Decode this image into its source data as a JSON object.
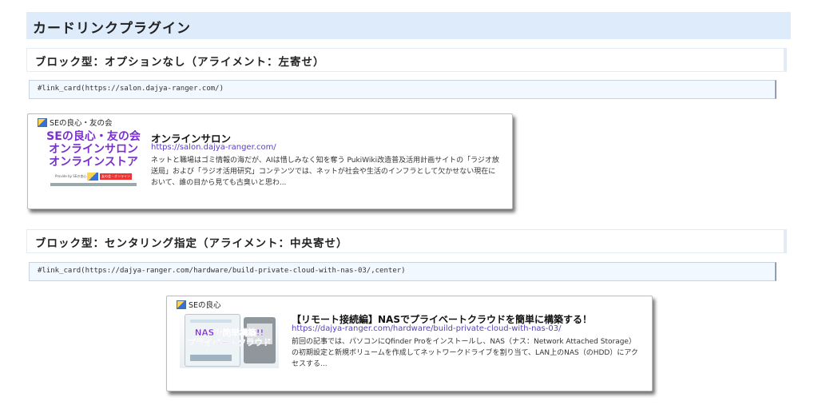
{
  "page": {
    "title": "カードリンクプラグイン"
  },
  "section1": {
    "heading": "ブロック型：オプションなし（アライメント：左寄せ）",
    "code": "#link_card(https://salon.dajya-ranger.com/)",
    "card": {
      "site_name": "SEの良心・友の会",
      "title": "オンラインサロン",
      "url": "https://salon.dajya-ranger.com/",
      "description": "ネットと職場はゴミ情報の海だが、AIは惜しみなく知を奪う PukiWiki改造普及活用計画サイトの「ラジオ放送局」および「ラジオ活用研究」コンテンツでは、ネットが社会や生活のインフラとして欠かせない現在において、誰の目から見ても古臭いと思わ...",
      "thumb_lines": [
        "SEの良心・友の会",
        "オンラインサロン",
        "オンラインストア"
      ],
      "thumb_footer": "Provide by SEの良心",
      "thumb_badge": "友の会・オンライン"
    }
  },
  "section2": {
    "heading": "ブロック型：センタリング指定（アライメント：中央寄せ）",
    "code": "#link_card(https://dajya-ranger.com/hardware/build-private-cloud-with-nas-03/,center)",
    "card": {
      "site_name": "SEの良心",
      "title": "【リモート接続編】NASでプライベートクラウドを簡単に構築する！",
      "url": "https://dajya-ranger.com/hardware/build-private-cloud-with-nas-03/",
      "description": "前回の記事では、パソコンにQfinder Proをインストールし、NAS（ナス：Network Attached Storage）の初期設定と新規ボリュームを作成してネットワークドライブを割り当て、LAN上のNAS（のHDD）にアクセスする...",
      "thumb_lines": [
        "NASで簡単構築!!",
        "プライベートクラウド"
      ]
    }
  },
  "colors": {
    "heading_bg": "#ddebfb",
    "code_bg": "#f2f8ff",
    "link": "#5a3fc0",
    "thumb_purple": "#7a2fd0"
  }
}
